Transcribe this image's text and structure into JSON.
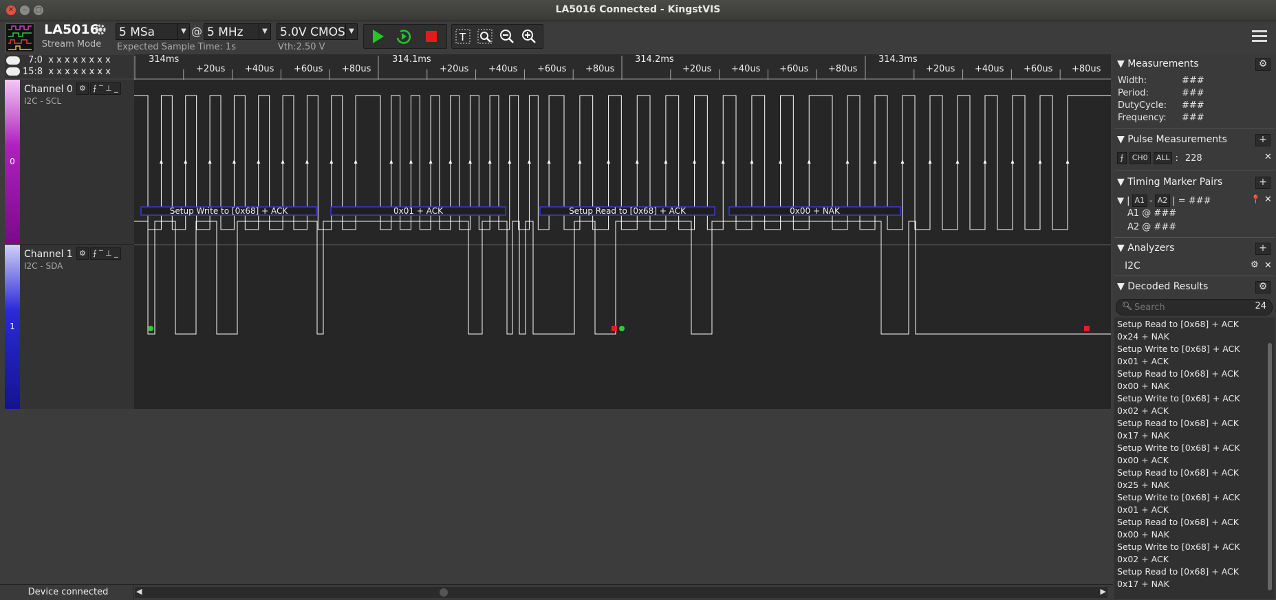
{
  "window": {
    "title": "LA5016 Connected - KingstVIS"
  },
  "device": {
    "name": "LA5016",
    "mode": "Stream Mode"
  },
  "sample": {
    "depth": "5 MSa",
    "at": "@",
    "rate": "5 MHz",
    "expected_time": "Expected Sample Time: 1s"
  },
  "threshold": {
    "value": "5.0V CMOS",
    "vth": "Vth:2.50 V"
  },
  "groups": [
    {
      "label": "7:0",
      "values": "x x x x x x x x"
    },
    {
      "label": "15:8",
      "values": "x x x x x x x x"
    }
  ],
  "ruler": {
    "major": [
      "314ms",
      "314.1ms",
      "314.2ms",
      "314.3ms"
    ],
    "minor": [
      "+20us",
      "+40us",
      "+60us",
      "+80us"
    ]
  },
  "channels": [
    {
      "name": "Channel 0",
      "sub": "I2C - SCL",
      "num": "0",
      "color": "#b020c0"
    },
    {
      "name": "Channel 1",
      "sub": "I2C - SDA",
      "num": "1",
      "color": "#2a2ad8"
    }
  ],
  "decode_bars": [
    "Setup Write to [0x68] + ACK",
    "0x01 + ACK",
    "Setup Read to [0x68] + ACK",
    "0x00 + NAK"
  ],
  "measurements": {
    "title": "Measurements",
    "rows": [
      {
        "k": "Width:",
        "v": "###"
      },
      {
        "k": "Period:",
        "v": "###"
      },
      {
        "k": "DutyCycle:",
        "v": "###"
      },
      {
        "k": "Frequency:",
        "v": "###"
      }
    ]
  },
  "pulse": {
    "title": "Pulse Measurements",
    "ch": "CH0",
    "all": "ALL",
    "colon": ":",
    "count": "228"
  },
  "timing": {
    "title": "Timing Marker Pairs",
    "a1": "A1",
    "dash": "-",
    "a2": "A2",
    "eq": "= ###",
    "a1v": "A1 @ ###",
    "a2v": "A2 @ ###"
  },
  "analyzers": {
    "title": "Analyzers",
    "item": "I2C"
  },
  "decoded": {
    "title": "Decoded Results",
    "search_placeholder": "Search",
    "count": "24",
    "items": [
      "Setup Read to [0x68] + ACK",
      "0x24 + NAK",
      "Setup Write to [0x68] + ACK",
      "0x01 + ACK",
      "Setup Read to [0x68] + ACK",
      "0x00 + NAK",
      "Setup Write to [0x68] + ACK",
      "0x02 + ACK",
      "Setup Read to [0x68] + ACK",
      "0x17 + NAK",
      "Setup Write to [0x68] + ACK",
      "0x00 + ACK",
      "Setup Read to [0x68] + ACK",
      "0x25 + NAK",
      "Setup Write to [0x68] + ACK",
      "0x01 + ACK",
      "Setup Read to [0x68] + ACK",
      "0x00 + NAK",
      "Setup Write to [0x68] + ACK",
      "0x02 + ACK",
      "Setup Read to [0x68] + ACK",
      "0x17 + NAK"
    ]
  },
  "status": {
    "text": "Device connected"
  }
}
